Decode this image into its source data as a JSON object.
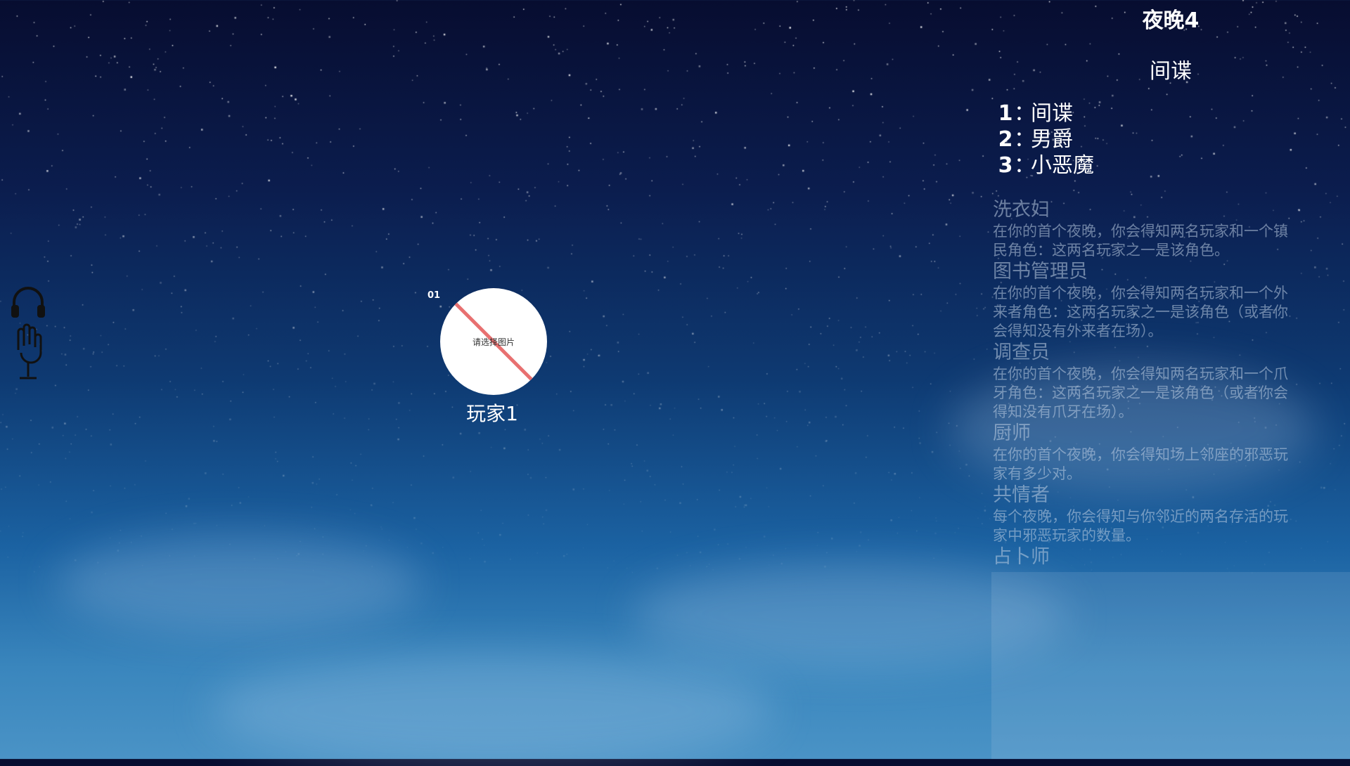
{
  "night": {
    "title": "夜晚4"
  },
  "role": {
    "title": "间谍"
  },
  "options": [
    {
      "num": "1",
      "sep": "：",
      "label": "间谍"
    },
    {
      "num": "2",
      "sep": "：",
      "label": "男爵"
    },
    {
      "num": "3",
      "sep": "：",
      "label": "小恶魔"
    }
  ],
  "roles": [
    {
      "name": "洗衣妇",
      "desc": "在你的首个夜晚，你会得知两名玩家和一个镇民角色：这两名玩家之一是该角色。"
    },
    {
      "name": "图书管理员",
      "desc": "在你的首个夜晚，你会得知两名玩家和一个外来者角色：这两名玩家之一是该角色（或者你会得知没有外来者在场）。"
    },
    {
      "name": "调查员",
      "desc": "在你的首个夜晚，你会得知两名玩家和一个爪牙角色：这两名玩家之一是该角色（或者你会得知没有爪牙在场）。"
    },
    {
      "name": "厨师",
      "desc": "在你的首个夜晚，你会得知场上邻座的邪恶玩家有多少对。"
    },
    {
      "name": "共情者",
      "desc": "每个夜晚，你会得知与你邻近的两名存活的玩家中邪恶玩家的数量。"
    },
    {
      "name": "占卜师",
      "desc": ""
    }
  ],
  "player": {
    "seat": "01",
    "avatar_text": "请选择图片",
    "name": "玩家1"
  },
  "icons": {
    "headphones": "headphones-icon",
    "microphone": "microphone-hand-icon"
  },
  "colors": {
    "text": "#ffffff",
    "role_text": "#bccde0",
    "slash": "#e87070"
  }
}
